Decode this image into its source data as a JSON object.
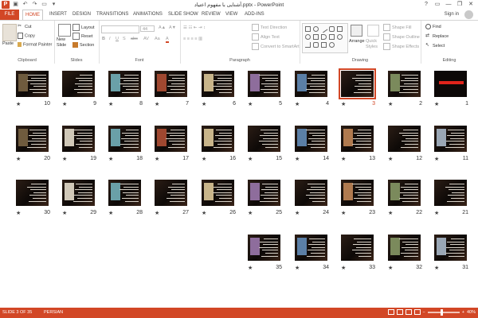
{
  "window": {
    "title": "آشنایی با مفهوم اعتیاد.pptx - PowerPoint",
    "controls": [
      "?",
      "▭",
      "—",
      "❐",
      "✕"
    ]
  },
  "tabs": [
    "FILE",
    "HOME",
    "INSERT",
    "DESIGN",
    "TRANSITIONS",
    "ANIMATIONS",
    "SLIDE SHOW",
    "REVIEW",
    "VIEW",
    "ADD-INS"
  ],
  "active_tab": "HOME",
  "signin": "Sign in",
  "ribbon": {
    "clipboard": {
      "label": "Clipboard",
      "paste": "Paste",
      "cut": "Cut",
      "copy": "Copy",
      "format_painter": "Format Painter"
    },
    "slides": {
      "label": "Slides",
      "new_slide": "New Slide",
      "layout": "Layout",
      "reset": "Reset",
      "section": "Section"
    },
    "font": {
      "label": "Font",
      "size": "44"
    },
    "paragraph": {
      "label": "Paragraph",
      "text_direction": "Text Direction",
      "align_text": "Align Text",
      "convert_smartart": "Convert to SmartArt"
    },
    "drawing": {
      "label": "Drawing",
      "arrange": "Arrange",
      "quick_styles": "Quick Styles",
      "shape_fill": "Shape Fill",
      "shape_outline": "Shape Outline",
      "shape_effects": "Shape Effects"
    },
    "editing": {
      "label": "Editing",
      "find": "Find",
      "replace": "Replace",
      "select": "Select"
    }
  },
  "slides": {
    "total": 35,
    "selected": 3,
    "rows": [
      [
        10,
        9,
        8,
        7,
        6,
        5,
        4,
        3,
        2,
        1
      ],
      [
        20,
        19,
        18,
        17,
        16,
        15,
        14,
        13,
        12,
        11
      ],
      [
        30,
        29,
        28,
        27,
        26,
        25,
        24,
        23,
        22,
        21
      ],
      [
        35,
        34,
        33,
        32,
        31
      ]
    ],
    "star": "★"
  },
  "status": {
    "slide_info": "SLIDE 3 OF 35",
    "language": "PERSIAN",
    "zoom": "40%",
    "zoom_minus": "−",
    "zoom_plus": "+"
  },
  "colors": {
    "accent": "#d24726"
  }
}
